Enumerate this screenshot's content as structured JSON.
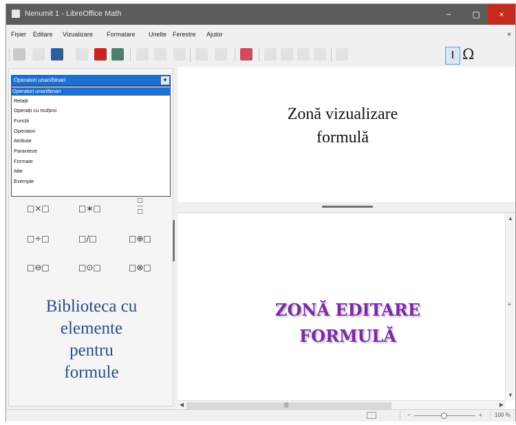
{
  "window": {
    "title": "Nenumit 1 - LibreOffice Math",
    "minimize": "−",
    "maximize": "▢",
    "close": "×"
  },
  "menu": {
    "items": [
      "Fișier",
      "Editare",
      "Vizualizare",
      "Formatare",
      "Unelte",
      "Ferestre",
      "Ajutor"
    ],
    "close": "×"
  },
  "toolbar": {
    "icons": [
      "new-document-icon",
      "open-icon",
      "save-icon",
      "email-icon",
      "export-pdf-icon",
      "print-icon",
      "cut-icon",
      "copy-icon",
      "paste-icon",
      "undo-icon",
      "redo-icon",
      "symbols-icon",
      "zoom-in-icon",
      "zoom-out-icon",
      "show-all-icon",
      "update-icon",
      "formula-cursor-icon",
      "omega-icon"
    ],
    "omega": "Ω"
  },
  "elements_panel": {
    "selected": "Operatori unari/binari",
    "options": [
      "Operatori unari/binari",
      "Relații",
      "Operații cu mulțimi",
      "Funcții",
      "Operatori",
      "Atribute",
      "Paranteze",
      "Formate",
      "Alte",
      "Exemple"
    ],
    "symbols": [
      "□×□",
      "□∗□",
      "□÷□",
      "□/□",
      "□⊕□",
      "□⊖□",
      "□⊙□",
      "□⊗□"
    ],
    "fraction_symbol": "□\n—\n□",
    "caption": [
      "Biblioteca cu",
      "elemente",
      "pentru",
      "formule"
    ]
  },
  "view_area": {
    "caption": [
      "Zonă vizualizare",
      "formulă"
    ]
  },
  "edit_area": {
    "caption": [
      "ZONĂ EDITARE",
      "FORMULĂ"
    ]
  },
  "status": {
    "minus": "−",
    "plus": "+",
    "zoom": "100 %"
  },
  "colors": {
    "accent": "#1e6fd2",
    "titlebar": "#5c5c5c",
    "close": "#c42b1c",
    "edit_caption": "#7a2aa3",
    "library_caption": "#2a4d8c"
  }
}
